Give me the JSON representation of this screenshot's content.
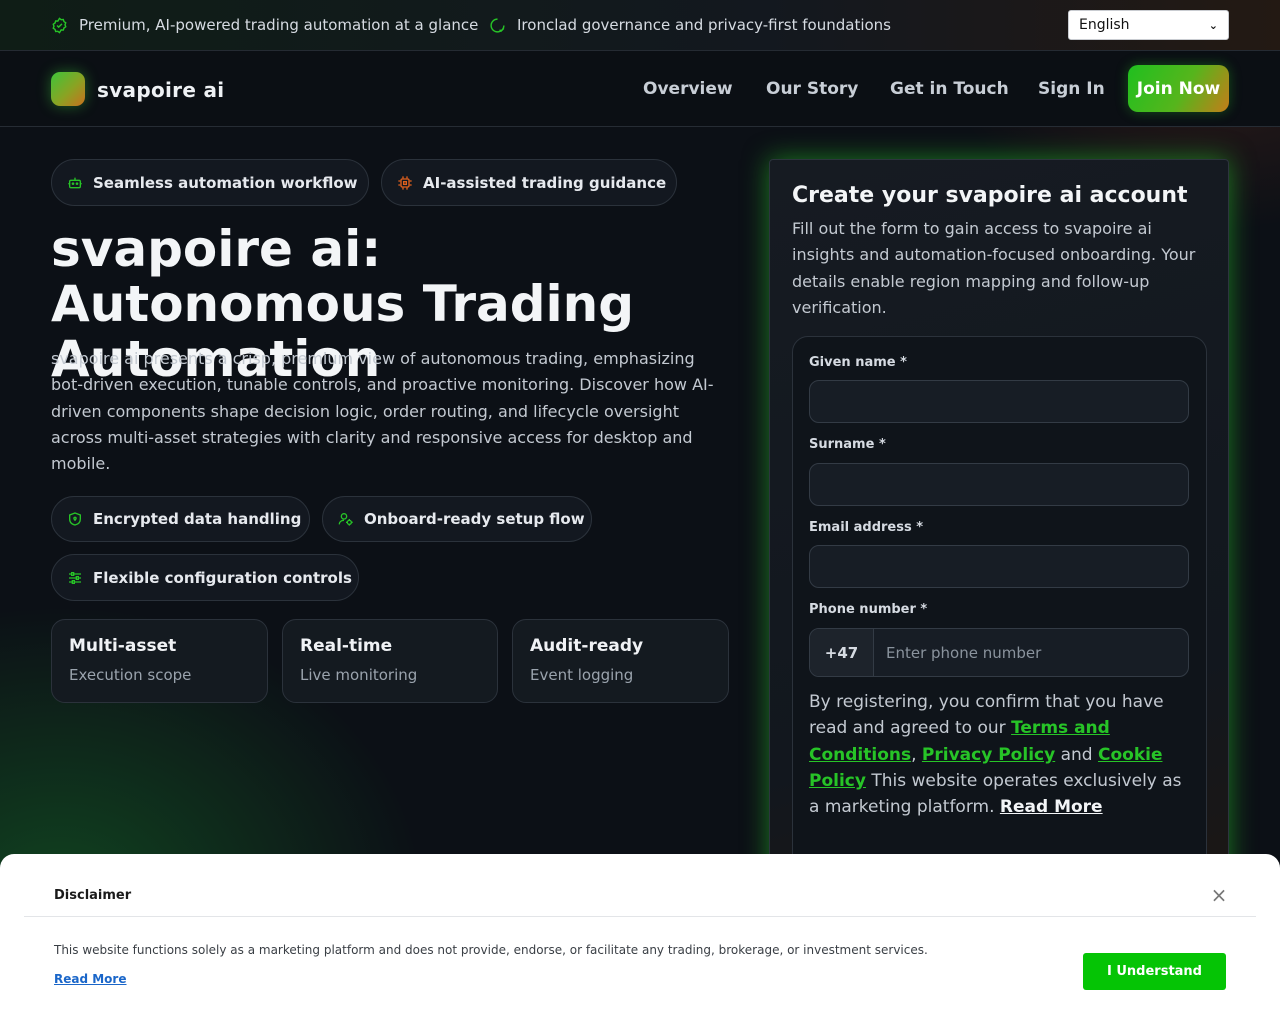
{
  "topbar": {
    "items": [
      {
        "label": "Premium, AI-powered trading automation at a glance",
        "icon": "check-badge-icon"
      },
      {
        "label": "Ironclad governance and privacy-first foundations",
        "icon": "shield-check-icon"
      }
    ],
    "language": "English"
  },
  "nav": {
    "brand": "svapoire ai",
    "links": [
      "Overview",
      "Our Story",
      "Get in Touch",
      "Sign In"
    ],
    "cta": "Join Now"
  },
  "hero": {
    "tags": [
      {
        "label": "Seamless automation workflow",
        "icon": "robot-icon"
      },
      {
        "label": "AI-assisted trading guidance",
        "icon": "chip-icon"
      }
    ],
    "title": "svapoire ai: Autonomous Trading Automation",
    "description": "svapoire ai presents a crisp, premium view of autonomous trading, emphasizing bot-driven execution, tunable controls, and proactive monitoring. Discover how AI-driven components shape decision logic, order routing, and lifecycle oversight across multi-asset strategies with clarity and responsive access for desktop and mobile.",
    "features": [
      {
        "label": "Encrypted data handling",
        "icon": "shield-icon"
      },
      {
        "label": "Onboard-ready setup flow",
        "icon": "user-gear-icon"
      },
      {
        "label": "Flexible configuration controls",
        "icon": "sliders-icon"
      }
    ],
    "stats": [
      {
        "title": "Multi-asset",
        "sub": "Execution scope"
      },
      {
        "title": "Real-time",
        "sub": "Live monitoring"
      },
      {
        "title": "Audit-ready",
        "sub": "Event logging"
      }
    ]
  },
  "signup": {
    "title": "Create your svapoire ai account",
    "description": "Fill out the form to gain access to svapoire ai insights and automation-focused onboarding. Your details enable region mapping and follow-up verification.",
    "fields": {
      "given_name": {
        "label": "Given name *",
        "value": ""
      },
      "surname": {
        "label": "Surname *",
        "value": ""
      },
      "email": {
        "label": "Email address *",
        "value": ""
      },
      "phone": {
        "label": "Phone number *",
        "code": "+47",
        "placeholder": "Enter phone number"
      }
    },
    "consent": {
      "prefix": "By registering, you confirm that you have read and agreed to our ",
      "terms": "Terms and Conditions",
      "comma": ", ",
      "privacy": "Privacy Policy",
      "and": " and ",
      "cookie": "Cookie Policy",
      "suffix": " This website operates exclusively as a marketing platform. ",
      "read_more": "Read More"
    }
  },
  "disclaimer": {
    "title": "Disclaimer",
    "text": "This website functions solely as a marketing platform and does not provide, endorse, or facilitate any trading, brokerage, or investment services.",
    "link": "Read More",
    "button": "I Understand",
    "close": "×"
  },
  "colors": {
    "accent": "#27c427",
    "button_green": "#05c405",
    "background": "#0c1016",
    "link_blue": "#1a66c9"
  }
}
